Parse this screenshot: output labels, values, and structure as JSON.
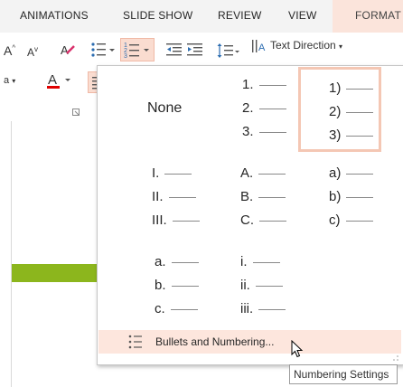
{
  "tabs": [
    "ANIMATIONS",
    "SLIDE SHOW",
    "REVIEW",
    "VIEW",
    "FORMAT"
  ],
  "ribbon": {
    "font_grow": "A",
    "font_shrink": "A",
    "text_direction_label": "Text Direction",
    "font_color_letter": "A",
    "font_size_fragment": "a"
  },
  "numbering_menu": {
    "none_label": "None",
    "styles": [
      [
        "1.",
        "2.",
        "3."
      ],
      [
        "1)",
        "2)",
        "3)"
      ],
      [
        "I.",
        "II.",
        "III."
      ],
      [
        "A.",
        "B.",
        "C."
      ],
      [
        "a)",
        "b)",
        "c)"
      ],
      [
        "a.",
        "b.",
        "c."
      ],
      [
        "i.",
        "ii.",
        "iii."
      ]
    ],
    "footer_label": "Bullets and Numbering...",
    "selected_style": "1)"
  },
  "tooltip": "Numbering Settings",
  "colors": {
    "accent": "#f4c7b4",
    "format_tab": "#fbe4db",
    "slide_green": "#8cb61d",
    "font_color_underline": "#e00000"
  }
}
